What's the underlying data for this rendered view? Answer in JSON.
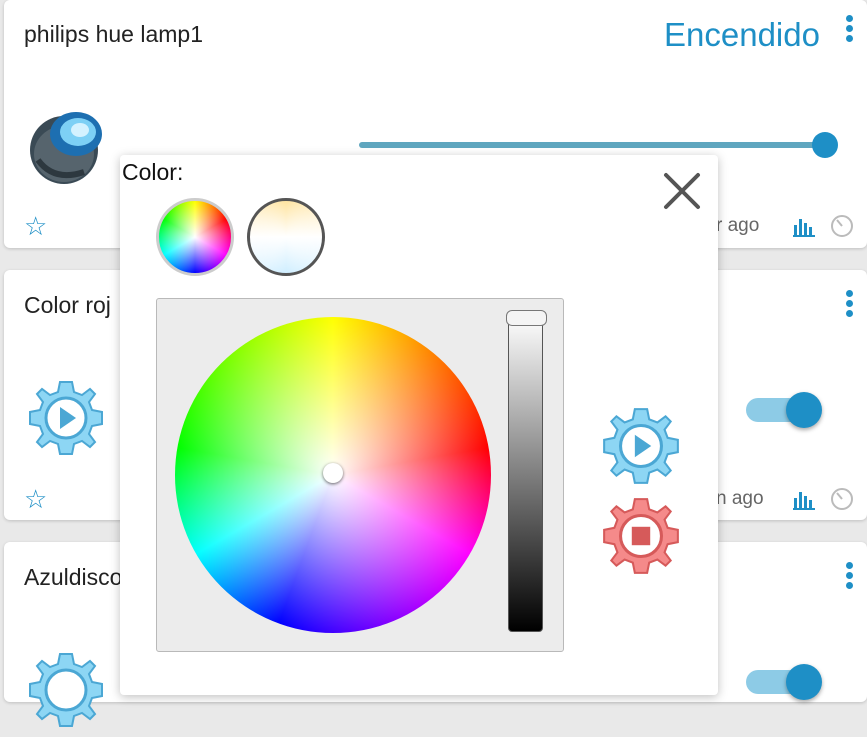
{
  "cards": [
    {
      "title": "philips hue lamp1",
      "status": "Encendido",
      "time": "r ago",
      "brightness": 1.0
    },
    {
      "title": "Color roj",
      "time": "n ago",
      "toggle": true
    },
    {
      "title": "Azuldisco",
      "toggle": true
    }
  ],
  "popup": {
    "label": "Color:",
    "close_icon": "close-icon",
    "selected_hue_deg": 0,
    "selected_saturation": 0,
    "brightness_level": 1.0
  },
  "colors": {
    "accent": "#1e8fc6",
    "play_blue": "#5bc0eb",
    "stop_red": "#f26a6a"
  }
}
